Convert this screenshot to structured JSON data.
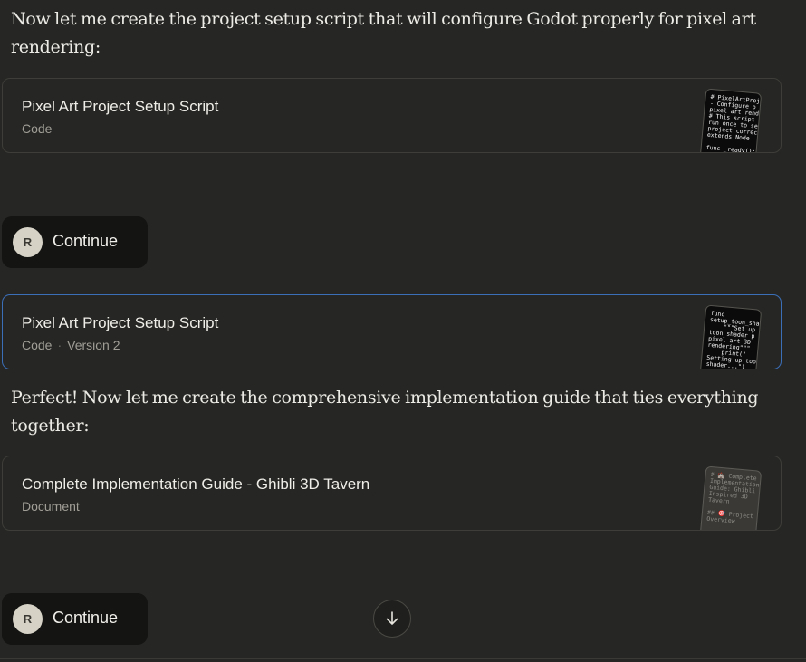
{
  "messages": {
    "intro_text": "Now let me create the project setup script that will configure Godot properly for pixel art rendering:",
    "perfect_text": "Perfect! Now let me create the comprehensive implementation guide that ties everything together:"
  },
  "artifacts": [
    {
      "title": "Pixel Art Project Setup Script",
      "type": "Code",
      "version": "",
      "preview": "# PixelArtProj\n- Configure p\npixel art rend\n# This script\nrun once to se\nproject correc\nextends Node\n\nfunc _ready():"
    },
    {
      "title": "Pixel Art Project Setup Script",
      "type": "Code",
      "version": "Version 2",
      "preview": "func\nsetup_toon_sha\n    \"\"\"Set up\ntoon shader p\npixel art 3D\nrendering\"\"\"\n    print(\"\nSetting up too\nshader...\")"
    },
    {
      "title": "Complete Implementation Guide - Ghibli 3D Tavern",
      "type": "Document",
      "version": "",
      "preview": "# 🏰 Complete\nImplementation\nGuide: Ghibli\nInspired 3D\nTavern\n\n## 🎯 Project\nOverview"
    }
  ],
  "continue_buttons": [
    {
      "avatar_initial": "R",
      "label": "Continue"
    },
    {
      "avatar_initial": "R",
      "label": "Continue"
    }
  ],
  "icons": {
    "scroll_down": "arrow-down-icon"
  },
  "colors": {
    "background": "#262624",
    "active_border": "#3b6fb8",
    "avatar_bg": "#d6d3c6"
  }
}
